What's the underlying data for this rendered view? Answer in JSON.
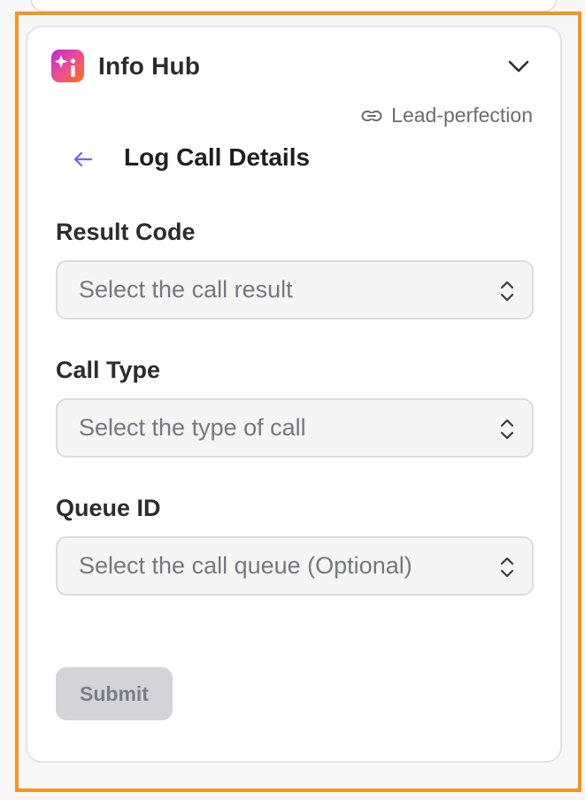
{
  "header": {
    "app_title": "Info Hub",
    "app_icon": "sparkle-info-icon",
    "collapse_icon": "chevron-down-icon"
  },
  "lead_link": {
    "icon": "link-icon",
    "label": "Lead-perfection"
  },
  "section": {
    "back_icon": "arrow-left-icon",
    "title": "Log Call Details"
  },
  "form": {
    "result_code": {
      "label": "Result Code",
      "placeholder": "Select the call result"
    },
    "call_type": {
      "label": "Call Type",
      "placeholder": "Select the type of call"
    },
    "queue_id": {
      "label": "Queue ID",
      "placeholder": "Select the call queue (Optional)"
    },
    "submit_label": "Submit"
  },
  "colors": {
    "highlight": "#f7941d",
    "accent": "#7c5cf6",
    "submit_disabled_bg": "#d4d4d8"
  }
}
